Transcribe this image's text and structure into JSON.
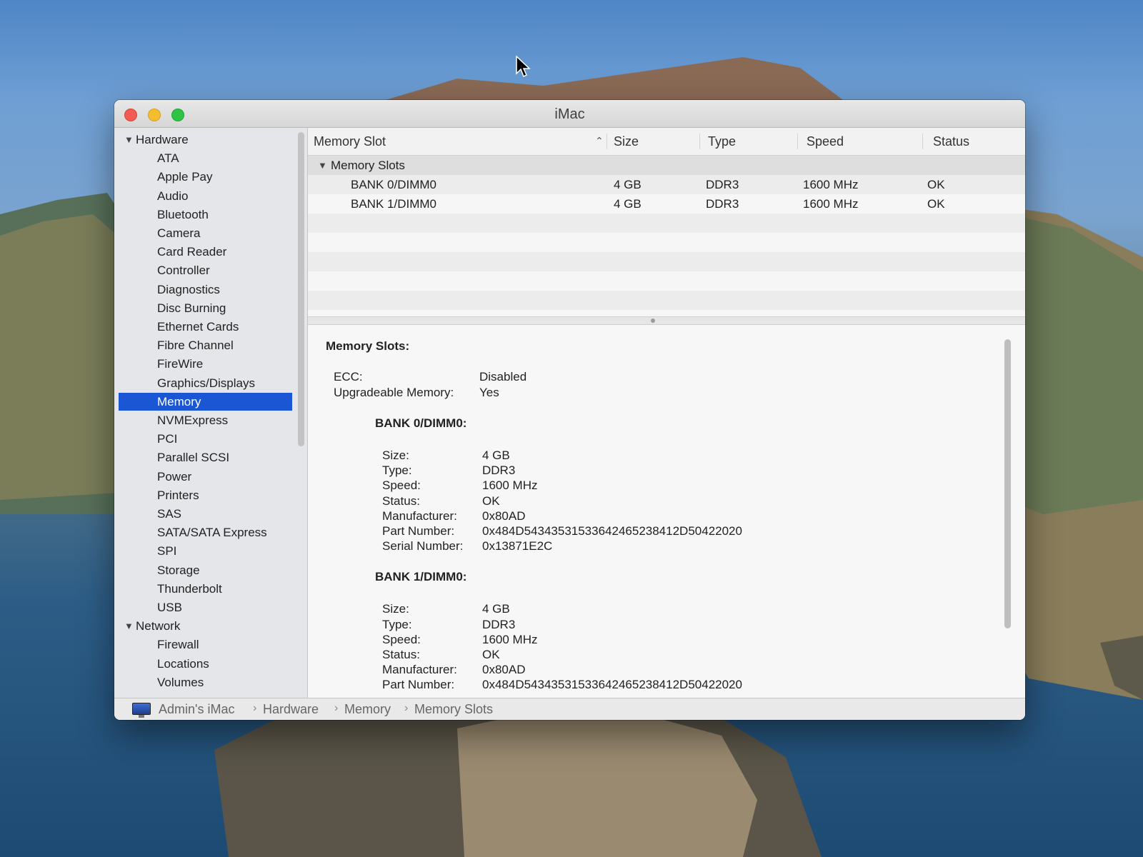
{
  "window": {
    "title": "iMac"
  },
  "sidebar": {
    "items": [
      {
        "label": "Hardware",
        "type": "group",
        "expanded": true
      },
      {
        "label": "ATA"
      },
      {
        "label": "Apple Pay"
      },
      {
        "label": "Audio"
      },
      {
        "label": "Bluetooth"
      },
      {
        "label": "Camera"
      },
      {
        "label": "Card Reader"
      },
      {
        "label": "Controller"
      },
      {
        "label": "Diagnostics"
      },
      {
        "label": "Disc Burning"
      },
      {
        "label": "Ethernet Cards"
      },
      {
        "label": "Fibre Channel"
      },
      {
        "label": "FireWire"
      },
      {
        "label": "Graphics/Displays"
      },
      {
        "label": "Memory",
        "selected": true
      },
      {
        "label": "NVMExpress"
      },
      {
        "label": "PCI"
      },
      {
        "label": "Parallel SCSI"
      },
      {
        "label": "Power"
      },
      {
        "label": "Printers"
      },
      {
        "label": "SAS"
      },
      {
        "label": "SATA/SATA Express"
      },
      {
        "label": "SPI"
      },
      {
        "label": "Storage"
      },
      {
        "label": "Thunderbolt"
      },
      {
        "label": "USB"
      },
      {
        "label": "Network",
        "type": "group",
        "expanded": true
      },
      {
        "label": "Firewall"
      },
      {
        "label": "Locations"
      },
      {
        "label": "Volumes"
      }
    ]
  },
  "table": {
    "headers": {
      "slot": "Memory Slot",
      "size": "Size",
      "type": "Type",
      "speed": "Speed",
      "status": "Status"
    },
    "group_label": "Memory Slots",
    "rows": [
      {
        "slot": "BANK 0/DIMM0",
        "size": "4 GB",
        "type": "DDR3",
        "speed": "1600 MHz",
        "status": "OK"
      },
      {
        "slot": "BANK 1/DIMM0",
        "size": "4 GB",
        "type": "DDR3",
        "speed": "1600 MHz",
        "status": "OK"
      }
    ]
  },
  "detail": {
    "heading": "Memory Slots:",
    "summary": [
      {
        "label": "ECC:",
        "value": "Disabled"
      },
      {
        "label": "Upgradeable Memory:",
        "value": "Yes"
      }
    ],
    "banks": [
      {
        "title": "BANK 0/DIMM0:",
        "fields": [
          {
            "label": "Size:",
            "value": "4 GB"
          },
          {
            "label": "Type:",
            "value": "DDR3"
          },
          {
            "label": "Speed:",
            "value": "1600 MHz"
          },
          {
            "label": "Status:",
            "value": "OK"
          },
          {
            "label": "Manufacturer:",
            "value": "0x80AD"
          },
          {
            "label": "Part Number:",
            "value": "0x484D5434353153364246523841​2D50422020"
          },
          {
            "label": "Serial Number:",
            "value": "0x13871E2C"
          }
        ]
      },
      {
        "title": "BANK 1/DIMM0:",
        "fields": [
          {
            "label": "Size:",
            "value": "4 GB"
          },
          {
            "label": "Type:",
            "value": "DDR3"
          },
          {
            "label": "Speed:",
            "value": "1600 MHz"
          },
          {
            "label": "Status:",
            "value": "OK"
          },
          {
            "label": "Manufacturer:",
            "value": "0x80AD"
          },
          {
            "label": "Part Number:",
            "value": "0x484D5434353153364246523841​2D50422020"
          }
        ]
      }
    ]
  },
  "breadcrumb": [
    "Admin's iMac",
    "Hardware",
    "Memory",
    "Memory Slots"
  ],
  "icons": {
    "window_buttons": [
      "close-icon",
      "minimize-icon",
      "zoom-icon"
    ],
    "expand": "disclosure-triangle-icon",
    "sort": "sort-ascending-icon",
    "computer": "imac-icon",
    "pointer": "mouse-pointer-icon"
  },
  "colors": {
    "selection": "#1b56d4",
    "close": "#f25a52",
    "minimize": "#f6bc2f",
    "zoom": "#2fc443"
  }
}
